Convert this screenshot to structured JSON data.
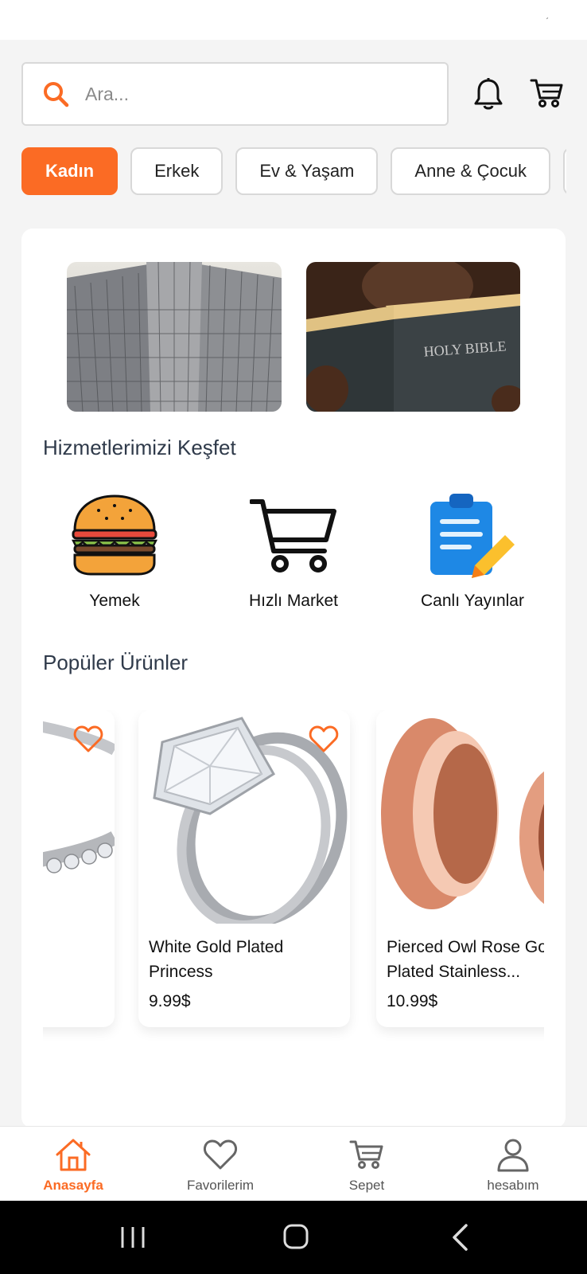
{
  "search": {
    "placeholder": "Ara..."
  },
  "categories": [
    "Kadın",
    "Erkek",
    "Ev & Yaşam",
    "Anne & Çocuk"
  ],
  "services_section": {
    "title": "Hizmetlerimizi Keşfet",
    "items": [
      "Yemek",
      "Hızlı Market",
      "Canlı Yayınlar"
    ]
  },
  "banners": {
    "book_text": "HOLY BIBLE"
  },
  "products_section": {
    "title": "Popüler Ürünler",
    "items": [
      {
        "name_line1": "White Gold Plated",
        "name_line2": "Princess",
        "price": "9.99$"
      },
      {
        "name_line1": "Pierced Owl Rose Gold",
        "name_line2": "Plated Stainless...",
        "price": "10.99$"
      }
    ]
  },
  "bottom_nav": [
    "Anasayfa",
    "Favorilerim",
    "Sepet",
    "hesabım"
  ],
  "colors": {
    "accent": "#fb6b24",
    "text_dark": "#2f3a4a"
  }
}
